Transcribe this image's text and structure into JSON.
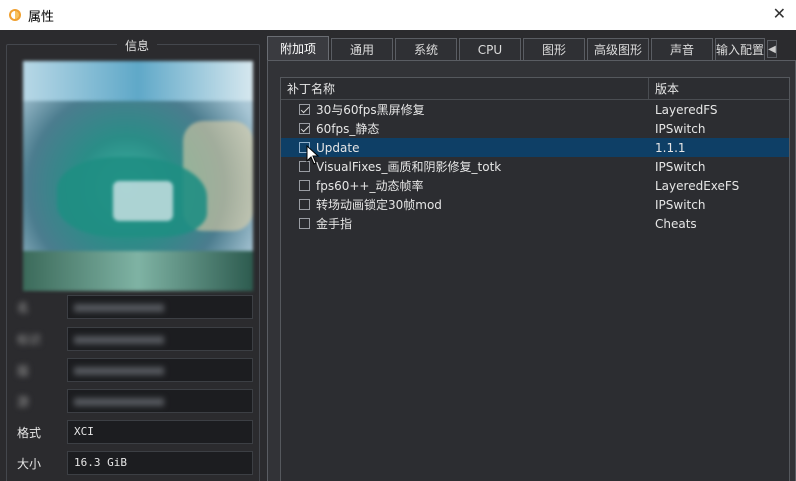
{
  "window": {
    "title": "属性"
  },
  "info": {
    "legend": "信息",
    "rows": [
      {
        "label": "名",
        "value": "",
        "redacted": true
      },
      {
        "label": "标识",
        "value": "",
        "redacted": true
      },
      {
        "label": "版",
        "value": "",
        "redacted": true
      },
      {
        "label": "游",
        "value": "",
        "redacted": true
      },
      {
        "label": "格式",
        "value": "XCI",
        "redacted": false
      },
      {
        "label": "大小",
        "value": "16.3 GiB",
        "redacted": false
      }
    ]
  },
  "tabs": [
    {
      "label": "附加项",
      "active": true
    },
    {
      "label": "通用",
      "active": false
    },
    {
      "label": "系统",
      "active": false
    },
    {
      "label": "CPU",
      "active": false
    },
    {
      "label": "图形",
      "active": false
    },
    {
      "label": "高级图形",
      "active": false
    },
    {
      "label": "声音",
      "active": false
    },
    {
      "label": "输入配置",
      "active": false
    }
  ],
  "addons": {
    "columns": {
      "name": "补丁名称",
      "version": "版本"
    },
    "rows": [
      {
        "name": "30与60fps黑屏修复",
        "version": "LayeredFS",
        "checked": true,
        "selected": false
      },
      {
        "name": "60fps_静态",
        "version": "IPSwitch",
        "checked": true,
        "selected": false
      },
      {
        "name": "Update",
        "version": "1.1.1",
        "checked": false,
        "selected": true
      },
      {
        "name": "VisualFixes_画质和阴影修复_totk",
        "version": "IPSwitch",
        "checked": false,
        "selected": false
      },
      {
        "name": "fps60++_动态帧率",
        "version": "LayeredExeFS",
        "checked": false,
        "selected": false
      },
      {
        "name": "转场动画锁定30帧mod",
        "version": "IPSwitch",
        "checked": false,
        "selected": false
      },
      {
        "name": "金手指",
        "version": "Cheats",
        "checked": false,
        "selected": false
      }
    ]
  }
}
